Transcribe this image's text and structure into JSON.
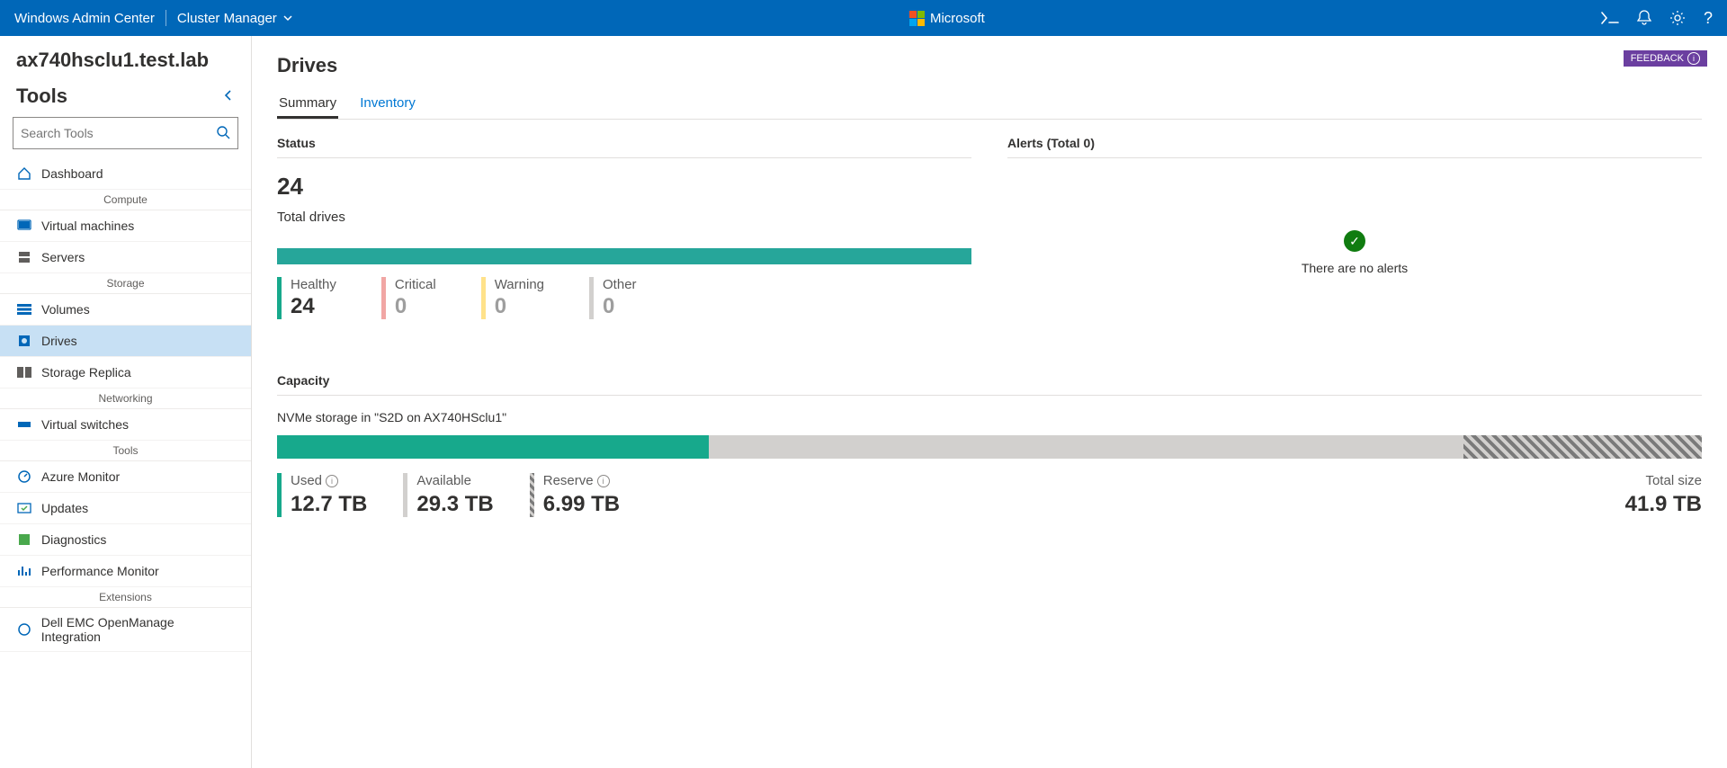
{
  "topbar": {
    "brand": "Windows Admin Center",
    "context": "Cluster Manager",
    "ms_label": "Microsoft"
  },
  "cluster_name": "ax740hsclu1.test.lab",
  "tools_header": "Tools",
  "search": {
    "placeholder": "Search Tools"
  },
  "nav": {
    "dashboard": "Dashboard",
    "groups": {
      "compute": "Compute",
      "storage": "Storage",
      "networking": "Networking",
      "tools": "Tools",
      "extensions": "Extensions"
    },
    "items": {
      "vms": "Virtual machines",
      "servers": "Servers",
      "volumes": "Volumes",
      "drives": "Drives",
      "storage_replica": "Storage Replica",
      "vswitches": "Virtual switches",
      "azure_monitor": "Azure Monitor",
      "updates": "Updates",
      "diagnostics": "Diagnostics",
      "perfmon": "Performance Monitor",
      "dell_omi": "Dell EMC OpenManage Integration"
    }
  },
  "main": {
    "title": "Drives",
    "feedback": "FEEDBACK",
    "tabs": {
      "summary": "Summary",
      "inventory": "Inventory"
    },
    "status": {
      "heading": "Status",
      "total_value": "24",
      "total_label": "Total drives",
      "healthy_label": "Healthy",
      "healthy_value": "24",
      "critical_label": "Critical",
      "critical_value": "0",
      "warning_label": "Warning",
      "warning_value": "0",
      "other_label": "Other",
      "other_value": "0"
    },
    "alerts": {
      "heading": "Alerts (Total 0)",
      "empty": "There are no alerts"
    },
    "capacity": {
      "heading": "Capacity",
      "storage_desc": "NVMe storage in \"S2D on AX740HSclu1\"",
      "used_label": "Used",
      "used_value": "12.7 TB",
      "avail_label": "Available",
      "avail_value": "29.3 TB",
      "reserve_label": "Reserve",
      "reserve_value": "6.99 TB",
      "total_label": "Total size",
      "total_value": "41.9 TB",
      "used_pct": 30.3,
      "avail_pct": 53.0,
      "reserve_pct": 16.7
    }
  }
}
